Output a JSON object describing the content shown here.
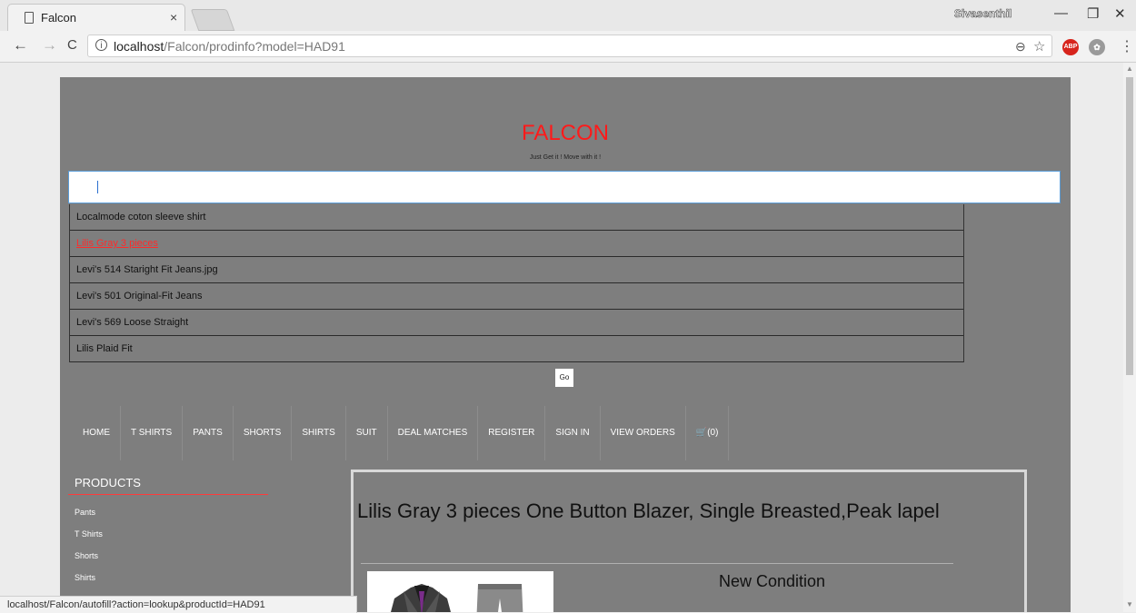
{
  "browser": {
    "tab_title": "Falcon",
    "tab_close": "×",
    "profile_name": "Sivasenthil",
    "window_controls": {
      "minimize": "—",
      "restore": "❐",
      "close": "✕"
    },
    "nav": {
      "back": "←",
      "forward": "→",
      "reload": "C"
    },
    "url_host": "localhost",
    "url_path": "/Falcon/prodinfo?model=HAD91",
    "zoom_icon": "⊖",
    "star_icon": "☆",
    "ext_abp": "ABP",
    "menu": "⋮",
    "status_url": "localhost/Falcon/autofill?action=lookup&productId=HAD91"
  },
  "site": {
    "brand": "FALCON",
    "tagline": "Just Get it ! Move with it !",
    "search_value": "",
    "suggestions": [
      "Localmode coton sleeve shirt",
      "Lilis Gray 3 pieces",
      "Levi's 514 Staright Fit Jeans.jpg",
      "Levi's 501 Original-Fit Jeans",
      "Levi's 569 Loose Straight",
      "Lilis Plaid Fit"
    ],
    "go_label": "Go",
    "nav": [
      "HOME",
      "T SHIRTS",
      "PANTS",
      "SHORTS",
      "SHIRTS",
      "SUIT",
      "DEAL MATCHES",
      "REGISTER",
      "SIGN IN",
      "VIEW ORDERS",
      "(0)"
    ],
    "sidebar_title": "PRODUCTS",
    "sidebar_links": [
      "Pants",
      "T Shirts",
      "Shorts",
      "Shirts"
    ],
    "product_title": " Lilis Gray 3 pieces One Button Blazer, Single Breasted,Peak lapel",
    "condition": "New Condition"
  },
  "colors": {
    "brand": "#ff1a1a",
    "page_bg": "#7e7e7e",
    "highlight": "#ff2a2a"
  }
}
